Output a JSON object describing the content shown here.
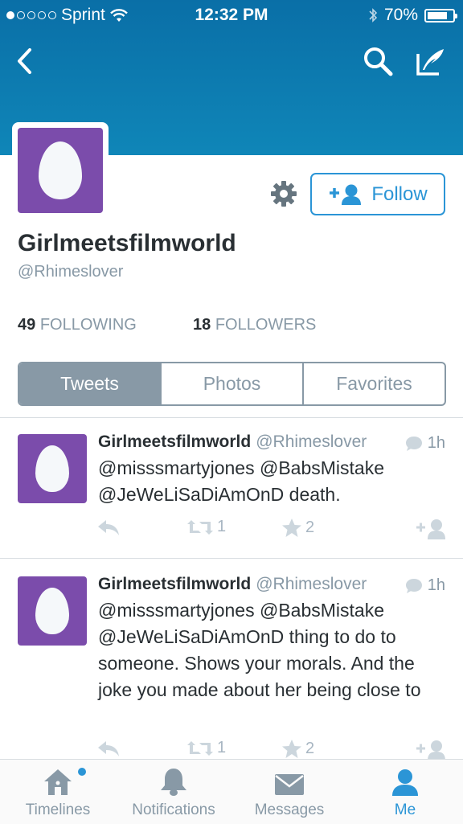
{
  "status_bar": {
    "carrier": "Sprint",
    "time": "12:32 PM",
    "battery": "70%",
    "battery_level": 0.7,
    "signal_bars": 1
  },
  "nav": {
    "back_icon": "chevron-left-icon",
    "search_icon": "search-icon",
    "compose_icon": "compose-icon"
  },
  "profile": {
    "name": "Girlmeetsfilmworld",
    "handle": "@Rhimeslover",
    "following_count": "49",
    "following_label": "FOLLOWING",
    "followers_count": "18",
    "followers_label": "FOLLOWERS",
    "follow_label": "Follow"
  },
  "tabs": [
    "Tweets",
    "Photos",
    "Favorites"
  ],
  "tweets": [
    {
      "name": "Girlmeetsfilmworld",
      "handle": "@Rhimeslover",
      "time": "1h",
      "text": "@misssmartyjones @BabsMistake @JeWeLiSaDiAmOnD death.",
      "retweets": "1",
      "favorites": "2"
    },
    {
      "name": "Girlmeetsfilmworld",
      "handle": "@Rhimeslover",
      "time": "1h",
      "text": "@misssmartyjones @BabsMistake @JeWeLiSaDiAmOnD thing to do to someone. Shows your morals. And the joke you made about her being close to",
      "retweets": "1",
      "favorites": "2"
    }
  ],
  "tabbar": [
    {
      "label": "Timelines",
      "icon": "home-icon"
    },
    {
      "label": "Notifications",
      "icon": "bell-icon"
    },
    {
      "label": "Messages",
      "icon": "envelope-icon"
    },
    {
      "label": "Me",
      "icon": "person-icon"
    }
  ],
  "colors": {
    "accent": "#2b95d6",
    "header": "#0f86b8",
    "avatar": "#7b4cab",
    "muted": "#8899a6"
  }
}
